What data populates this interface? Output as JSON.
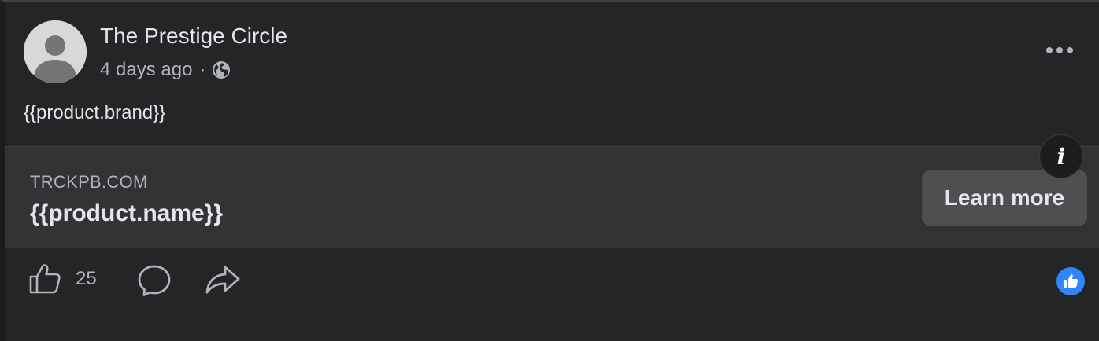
{
  "post": {
    "page_name": "The Prestige Circle",
    "timestamp": "4 days ago",
    "separator": "·",
    "audience_icon": "globe-icon",
    "more_icon": "ellipsis-icon",
    "body_text": "{{product.brand}}"
  },
  "link_card": {
    "domain": "TRCKPB.COM",
    "title": "{{product.name}}",
    "cta_label": "Learn more",
    "info_label": "i"
  },
  "actions": {
    "like_icon": "thumbs-up-icon",
    "like_count": "25",
    "comment_icon": "comment-icon",
    "share_icon": "share-icon",
    "reaction_icon": "like-reaction-icon"
  },
  "colors": {
    "background": "#242526",
    "card": "#323334",
    "text_primary": "#e4e6eb",
    "text_secondary": "#b0b3b8",
    "button": "#4e4f50",
    "like_blue": "#2d88ff"
  }
}
